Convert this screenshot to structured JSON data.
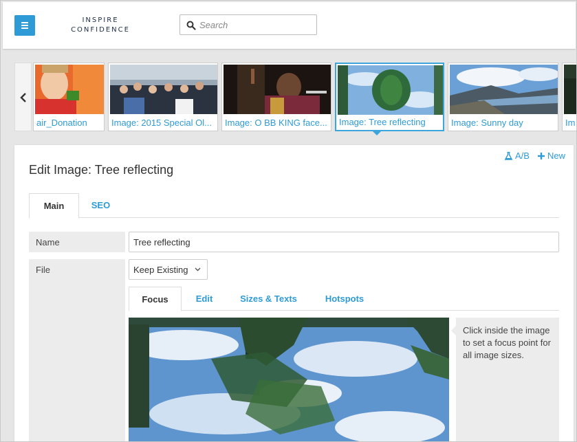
{
  "header": {
    "logo_line1": "INSPIRE",
    "logo_line2": "CONFIDENCE",
    "search_placeholder": "Search"
  },
  "carousel": {
    "items": [
      {
        "caption": "air_Donation"
      },
      {
        "caption": "Image: 2015 Special Ol..."
      },
      {
        "caption": "Image: O BB KING face..."
      },
      {
        "caption": "Image: Tree reflecting",
        "selected": true
      },
      {
        "caption": "Image: Sunny day"
      },
      {
        "caption": "Im"
      }
    ]
  },
  "panel": {
    "ab_label": "A/B",
    "new_label": "New",
    "title": "Edit Image: Tree reflecting",
    "tabs": [
      {
        "label": "Main"
      },
      {
        "label": "SEO"
      }
    ]
  },
  "form": {
    "name_label": "Name",
    "name_value": "Tree reflecting",
    "file_label": "File",
    "file_option": "Keep Existing",
    "subtabs": [
      {
        "label": "Focus"
      },
      {
        "label": "Edit"
      },
      {
        "label": "Sizes & Texts"
      },
      {
        "label": "Hotspots"
      }
    ],
    "hint": "Click inside the image to set a focus point for all image sizes."
  },
  "colors": {
    "accent": "#2e9bd6",
    "logo": "#1b2b48"
  }
}
